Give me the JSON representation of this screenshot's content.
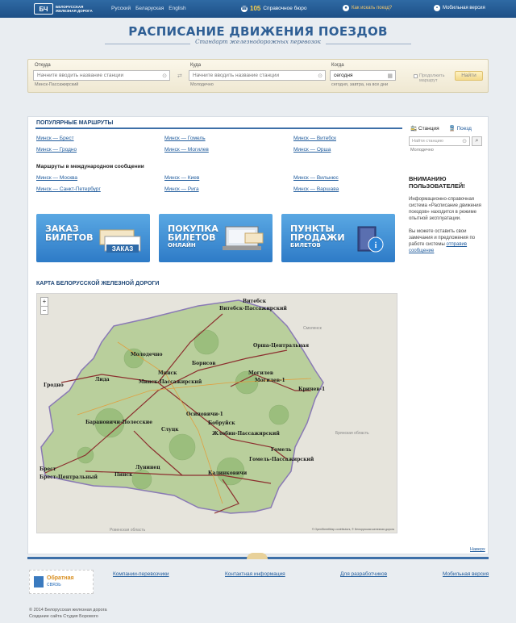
{
  "topbar": {
    "logo_mark": "БЧ",
    "logo_text_line1": "Белорусская",
    "logo_text_line2": "железная дорога",
    "languages": [
      "Русский",
      "Беларуская",
      "English"
    ],
    "phone_number": "105",
    "phone_label": "Справочное бюро",
    "how_to_search": "Как искать поезд?",
    "mobile_version": "Мобильная версия"
  },
  "header": {
    "title": "РАСПИСАНИЕ ДВИЖЕНИЯ ПОЕЗДОВ",
    "subtitle": "Стандарт железнодорожных перевозок"
  },
  "search": {
    "from_label": "Откуда",
    "from_placeholder": "Начните вводить название станции",
    "from_hint": "Минск-Пассажирский",
    "to_label": "Куда",
    "to_placeholder": "Начните вводить название станции",
    "to_hint": "Молодечно",
    "when_label": "Когда",
    "when_value": "сегодня",
    "when_hint": "сегодня, завтра, на все дни",
    "checkbox_label": "Продолжить маршрут",
    "submit_label": "Найти"
  },
  "popular": {
    "title": "ПОПУЛЯРНЫЕ МАРШРУТЫ",
    "routes": [
      "Минск — Брест",
      "Минск — Гомель",
      "Минск — Витебск",
      "Минск — Гродно",
      "Минск — Могилев",
      "Минск — Орша"
    ],
    "intl_title": "Маршруты в международном сообщении",
    "intl_routes": [
      "Минск — Москва",
      "Минск — Киев",
      "Минск — Вильнюс",
      "Минск — Санкт-Петербург",
      "Минск — Рига",
      "Минск — Варшава"
    ]
  },
  "banners": [
    {
      "title_line1": "ЗАКАЗ",
      "title_line2": "БИЛЕТОВ",
      "small": "",
      "badge": "ЗАКАЗ"
    },
    {
      "title_line1": "ПОКУПКА",
      "title_line2": "БИЛЕТОВ",
      "small": "ОНЛАЙН",
      "badge": ""
    },
    {
      "title_line1": "ПУНКТЫ",
      "title_line2": "ПРОДАЖИ",
      "small": "БИЛЕТОВ",
      "badge": ""
    }
  ],
  "map": {
    "title": "КАРТА БЕЛОРУССКОЙ ЖЕЛЕЗНОЙ ДОРОГИ",
    "credit": "© OpenStreetMap contributors, © Белорусская железная дорога",
    "cities": [
      "Витебск",
      "Витебск-Пассажирский",
      "Смоленск",
      "Молодечно",
      "Борисов",
      "Орша-Центральная",
      "Минск",
      "Минск-Пассажирский",
      "Могилев",
      "Могилев-1",
      "Лида",
      "Гродно",
      "Кричев-1",
      "Осиповичи-1",
      "Барановичи-Полесские",
      "Слуцк",
      "Бобруйск",
      "Жлобин-Пассажирский",
      "Гомель",
      "Гомель-Пассажирский",
      "Брест",
      "Брест-Центральный",
      "Пинск",
      "Лунинец",
      "Калинковичи",
      "Брянская область",
      "Ровенская область"
    ]
  },
  "sidebar": {
    "tab_station": "Станция",
    "tab_train": "Поезд",
    "input_placeholder": "Найти станцию",
    "input_hint": "Молодечно",
    "notice_title": "ВНИМАНИЮ ПОЛЬЗОВАТЕЛЕЙ!",
    "notice_text": "Информационно-справочная система «Расписание движения поездов» находится в режиме опытной эксплуатации.",
    "notice_text2": "Вы можете оставить свои замечания и предложения по работе системы",
    "notice_link": "отправив сообщение",
    "back_link": "Наверх"
  },
  "footer": {
    "feedback_title": "Обратная",
    "feedback_sub": "связь",
    "links": [
      "Компании-перевозчики",
      "Контактная информация",
      "Для разработчиков",
      "Мобильная версия"
    ],
    "copyright": "© 2014 Белорусская железная дорога",
    "credit": "Создание сайта Студия Борового"
  },
  "colors": {
    "primary_blue": "#2f6aa4",
    "link": "#1f5b9c",
    "accent_yellow": "#ffd24a"
  }
}
